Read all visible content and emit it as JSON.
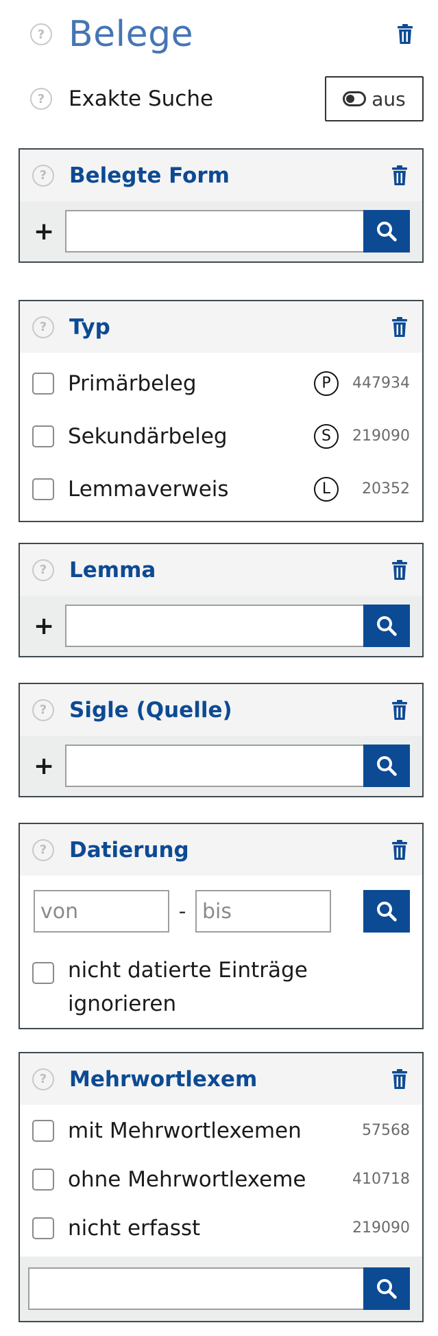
{
  "header": {
    "title": "Belege",
    "help": "?"
  },
  "exact_search": {
    "label": "Exakte Suche",
    "toggle_label": "aus"
  },
  "panels": {
    "belegte_form": {
      "title": "Belegte Form",
      "plus": "+",
      "value": ""
    },
    "typ": {
      "title": "Typ",
      "options": [
        {
          "label": "Primärbeleg",
          "badge": "P",
          "count": "447934"
        },
        {
          "label": "Sekundärbeleg",
          "badge": "S",
          "count": "219090"
        },
        {
          "label": "Lemmaverweis",
          "badge": "L",
          "count": "20352"
        }
      ]
    },
    "lemma": {
      "title": "Lemma",
      "plus": "+",
      "value": ""
    },
    "sigle": {
      "title": "Sigle (Quelle)",
      "plus": "+",
      "value": ""
    },
    "datierung": {
      "title": "Datierung",
      "from_placeholder": "von",
      "to_placeholder": "bis",
      "separator": "-",
      "undated_label": "nicht datierte Einträge ignorieren"
    },
    "mehrwortlexem": {
      "title": "Mehrwortlexem",
      "options": [
        {
          "label": "mit Mehrwortlexemen",
          "count": "57568"
        },
        {
          "label": "ohne Mehrwortlexeme",
          "count": "410718"
        },
        {
          "label": "nicht erfasst",
          "count": "219090"
        }
      ],
      "value": ""
    }
  },
  "icons": {
    "help": "help-circle-icon",
    "trash": "trash-icon",
    "search": "search-icon",
    "toggle": "toggle-off-icon"
  },
  "colors": {
    "accent": "#0d4a94",
    "title": "#4575b4",
    "panel_border": "#3e4a4f",
    "panel_header_bg": "#f4f4f4"
  }
}
